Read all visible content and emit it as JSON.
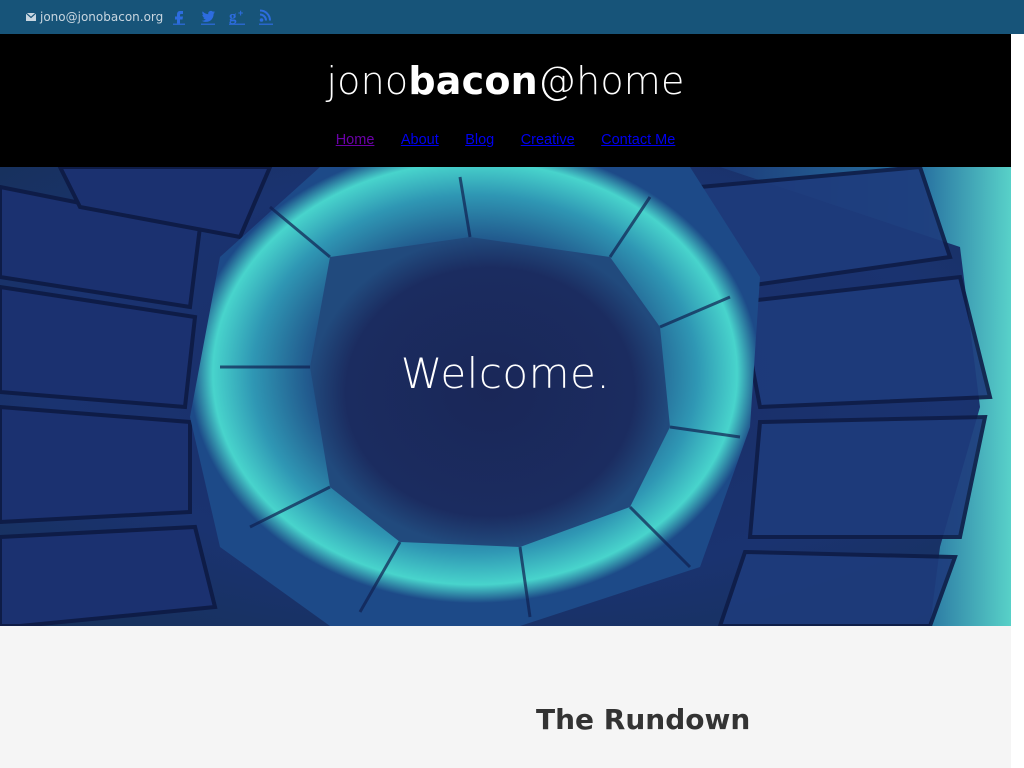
{
  "topbar": {
    "email": "jono@jonobacon.org",
    "email_icon": "envelope-icon",
    "social": [
      {
        "name": "facebook-icon",
        "glyph": "f"
      },
      {
        "name": "twitter-icon",
        "glyph": "t"
      },
      {
        "name": "google-plus-icon",
        "glyph": "g+"
      },
      {
        "name": "rss-icon",
        "glyph": "rss"
      }
    ]
  },
  "header": {
    "title_light_1": "jono",
    "title_bold": "bacon",
    "title_light_2": "@home",
    "nav": {
      "home": "Home",
      "about": "About",
      "blog": "Blog",
      "creative": "Creative",
      "contact": "Contact Me"
    }
  },
  "hero": {
    "title": "Welcome."
  },
  "content": {
    "heading": "The Rundown"
  },
  "colors": {
    "topbar": "#175479",
    "header": "#000000",
    "hero_dark": "#142355",
    "hero_glow": "#3fd0c8",
    "link": "#0000ee",
    "visited_link": "#6a00a8"
  }
}
